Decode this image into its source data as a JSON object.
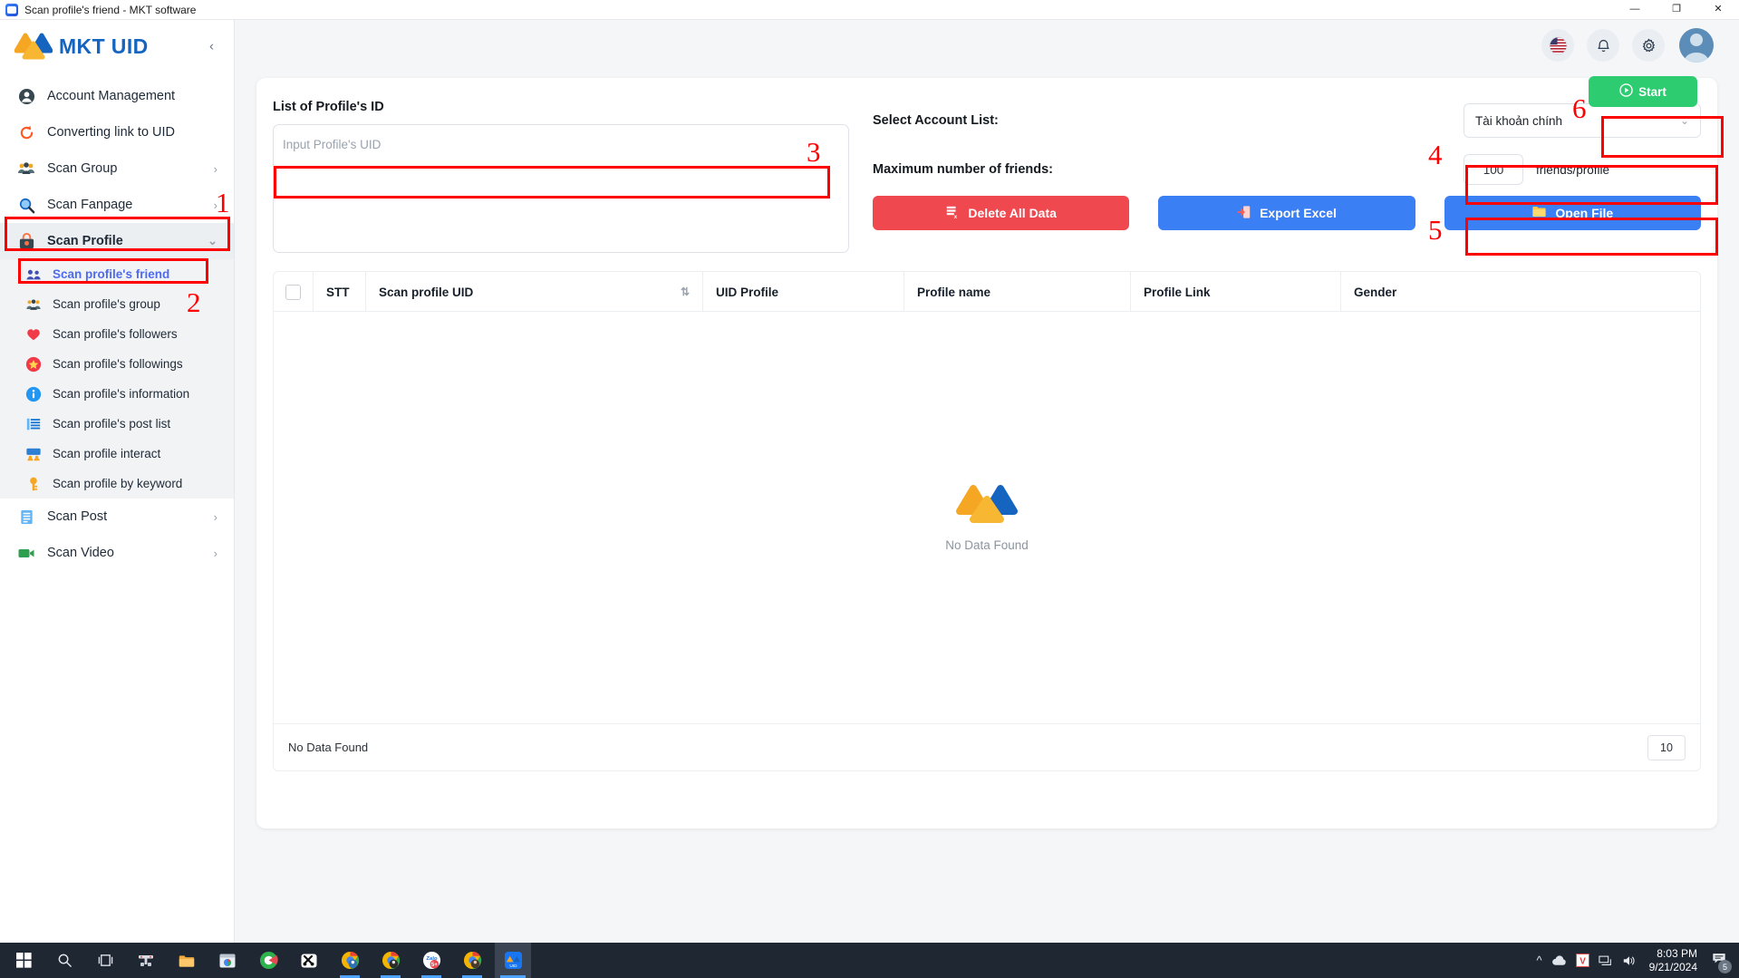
{
  "window": {
    "title": "Scan profile's friend - MKT software",
    "app_icon": "app-icon",
    "minimize": "—",
    "maximize": "❐",
    "close": "✕"
  },
  "sidebar": {
    "brand": "MKT UID",
    "collapse_icon": "‹",
    "items": [
      {
        "label": "Account Management",
        "icon": "user-circle-icon",
        "arrow": ""
      },
      {
        "label": "Converting link to UID",
        "icon": "refresh-icon",
        "arrow": ""
      },
      {
        "label": "Scan Group",
        "icon": "group-icon",
        "arrow": "›"
      },
      {
        "label": "Scan Fanpage",
        "icon": "magnifier-icon",
        "arrow": "›"
      },
      {
        "label": "Scan Profile",
        "icon": "profile-lock-icon",
        "arrow": "⌄"
      }
    ],
    "submenu": [
      {
        "label": "Scan profile's friend",
        "icon": "friends-icon",
        "selected": true
      },
      {
        "label": "Scan profile's group",
        "icon": "people-icon",
        "selected": false
      },
      {
        "label": "Scan profile's followers",
        "icon": "heart-icon",
        "selected": false
      },
      {
        "label": "Scan profile's followings",
        "icon": "star-icon",
        "selected": false
      },
      {
        "label": "Scan profile's information",
        "icon": "info-icon",
        "selected": false
      },
      {
        "label": "Scan profile's post list",
        "icon": "list-icon",
        "selected": false
      },
      {
        "label": "Scan profile interact",
        "icon": "interact-icon",
        "selected": false
      },
      {
        "label": "Scan profile by keyword",
        "icon": "key-icon",
        "selected": false
      }
    ],
    "items_after": [
      {
        "label": "Scan Post",
        "icon": "post-icon",
        "arrow": "›"
      },
      {
        "label": "Scan Video",
        "icon": "video-icon",
        "arrow": "›"
      }
    ]
  },
  "topbar": {
    "language_icon": "us-flag-icon",
    "notification_icon": "bell-icon",
    "settings_icon": "gear-icon",
    "avatar_icon": "user-avatar"
  },
  "form": {
    "uid_list_label": "List of Profile's ID",
    "uid_placeholder": "Input Profile's UID",
    "uid_value": "",
    "account_list_label": "Select Account List:",
    "account_selected": "Tài khoản chính",
    "account_chevron": "⌄",
    "max_friends_label": "Maximum number of friends:",
    "max_friends_value": "100",
    "max_friends_unit": "friends/profile",
    "start_label": "Start",
    "start_icon": "play-circle-icon",
    "start_color": "#2ecc71"
  },
  "actions": [
    {
      "label": "Delete All Data",
      "icon": "delete-data-icon",
      "color": "#f0484f",
      "style": "red"
    },
    {
      "label": "Export Excel",
      "icon": "export-excel-icon",
      "color": "#3b7ff5",
      "style": "blue"
    },
    {
      "label": "Open File",
      "icon": "folder-icon",
      "color": "#3b7ff5",
      "style": "blue"
    }
  ],
  "table": {
    "columns": [
      "STT",
      "Scan profile UID",
      "UID Profile",
      "Profile name",
      "Profile Link",
      "Gender"
    ],
    "sort_icon": "sort-icon",
    "rows": [],
    "empty_text": "No Data Found",
    "footer_text": "No Data Found",
    "page_size": "10"
  },
  "annotations": [
    {
      "number": "1"
    },
    {
      "number": "2"
    },
    {
      "number": "3"
    },
    {
      "number": "4"
    },
    {
      "number": "5"
    },
    {
      "number": "6"
    }
  ],
  "taskbar": {
    "start_icon": "windows-start-icon",
    "search_icon": "search-icon",
    "taskview_icon": "task-view-icon",
    "apps": [
      "wifi-tool-icon",
      "file-explorer-icon",
      "chrome-store-icon",
      "green-circle-icon",
      "capcut-icon",
      "chrome-profile-1-icon",
      "chrome-profile-2-icon",
      "zalo-icon",
      "chrome-profile-3-icon",
      "mkt-uid-icon"
    ],
    "tray_up_icon": "^",
    "cloud_icon": "cloud-icon",
    "antivirus_icon": "V",
    "network_icon": "network-icon",
    "volume_icon": "volume-icon",
    "time": "8:03 PM",
    "date": "9/21/2024",
    "notification_icon": "message-icon",
    "notification_count": "5"
  }
}
